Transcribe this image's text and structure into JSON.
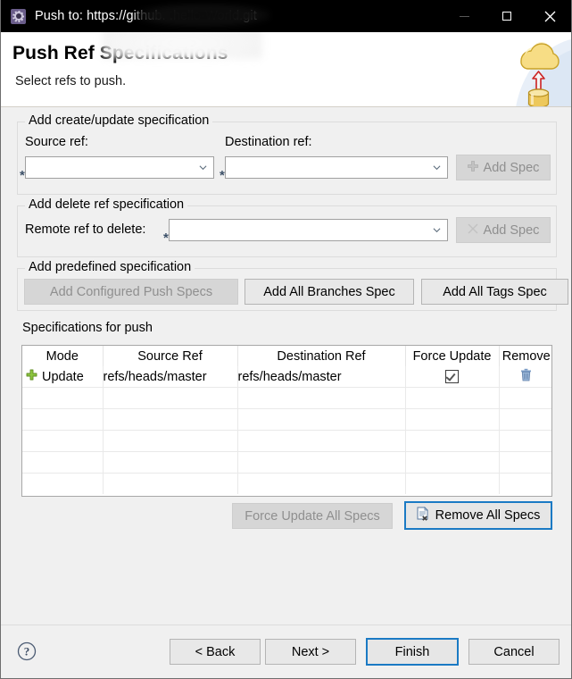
{
  "window": {
    "title": "Push to: https://github.                .hello-World.git",
    "app_icon": "gear-icon",
    "controls": {
      "minimize": "minimize-icon",
      "maximize": "maximize-icon",
      "close": "close-icon"
    }
  },
  "header": {
    "title": "Push Ref Specifications",
    "subtitle": "Select refs to push.",
    "banner_icon": "cloud-push-database-icon"
  },
  "create_update_group": {
    "legend": "Add create/update specification",
    "source_label": "Source ref:",
    "source_value": "",
    "source_required_marker": "*",
    "destination_label": "Destination ref:",
    "destination_value": "",
    "destination_required_marker": "*",
    "add_spec_label": "Add Spec",
    "add_spec_icon": "plus-icon",
    "add_spec_disabled": true
  },
  "delete_group": {
    "legend": "Add delete ref specification",
    "remote_label": "Remote ref to delete:",
    "remote_value": "",
    "remote_required_marker": "*",
    "add_spec_label": "Add Spec",
    "add_spec_icon": "x-mark-icon",
    "add_spec_disabled": true
  },
  "predefined_group": {
    "legend": "Add predefined specification",
    "buttons": [
      {
        "label": "Add Configured Push Specs",
        "disabled": true
      },
      {
        "label": "Add All Branches Spec",
        "disabled": false
      },
      {
        "label": "Add All Tags Spec",
        "disabled": false
      }
    ]
  },
  "specs_group": {
    "legend": "Specifications for push",
    "columns": [
      "Mode",
      "Source Ref",
      "Destination Ref",
      "Force Update",
      "Remove"
    ],
    "rows": [
      {
        "mode_icon": "green-plus-icon",
        "mode": "Update",
        "source_ref": "refs/heads/master",
        "destination_ref": "refs/heads/master",
        "force_update": true,
        "remove_icon": "trash-icon"
      }
    ],
    "empty_row_count": 5
  },
  "spec_actions": {
    "force_update_all_label": "Force Update All Specs",
    "force_update_all_disabled": true,
    "remove_all_label": "Remove All Specs",
    "remove_all_icon": "document-remove-icon",
    "remove_all_focused": true
  },
  "footer": {
    "help_icon": "help-circle-icon",
    "back_label": "< Back",
    "next_label": "Next >",
    "finish_label": "Finish",
    "cancel_label": "Cancel",
    "default_button": "Finish"
  },
  "colors": {
    "titlebar_bg": "#000000",
    "page_bg": "#f0f0f0",
    "header_bg": "#ffffff",
    "accent_focus": "#1b7ac4",
    "required_marker": "#3c5068",
    "green_plus": "#7bb03b",
    "trash_blue": "#7a9cc6",
    "arrow_red": "#cc2222",
    "cloud_yellow": "#f5d76e"
  }
}
